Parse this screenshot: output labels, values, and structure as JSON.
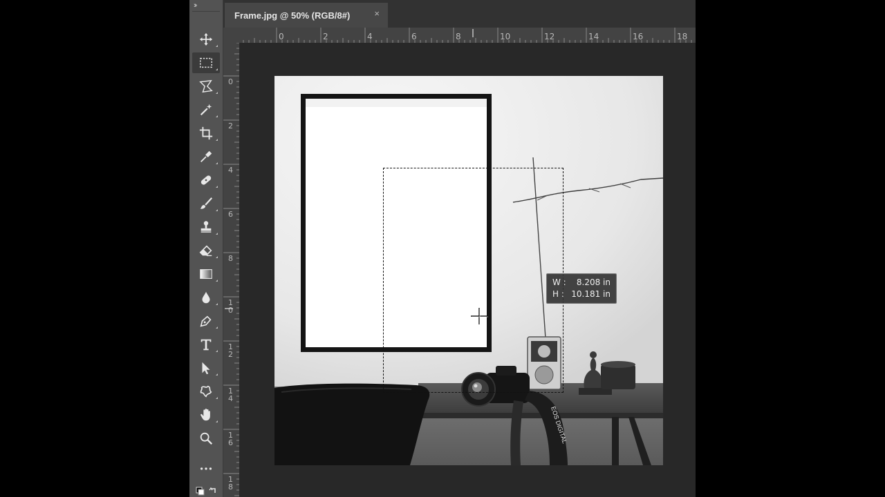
{
  "document_tab": {
    "title": "Frame.jpg @ 50% (RGB/8#)",
    "close_symbol": "×"
  },
  "toolbar": {
    "grip": "››",
    "tools": [
      {
        "name": "move-tool",
        "icon": "move-icon"
      },
      {
        "name": "rectangular-marquee-tool",
        "icon": "marquee-icon",
        "active": true
      },
      {
        "name": "polygonal-lasso-tool",
        "icon": "lasso-icon"
      },
      {
        "name": "magic-wand-tool",
        "icon": "magic-wand-icon"
      },
      {
        "name": "crop-tool",
        "icon": "crop-icon"
      },
      {
        "name": "eyedropper-tool",
        "icon": "eyedropper-icon"
      },
      {
        "name": "healing-brush-tool",
        "icon": "bandage-icon"
      },
      {
        "name": "brush-tool",
        "icon": "brush-icon"
      },
      {
        "name": "clone-stamp-tool",
        "icon": "stamp-icon"
      },
      {
        "name": "eraser-tool",
        "icon": "eraser-icon"
      },
      {
        "name": "gradient-tool",
        "icon": "gradient-icon"
      },
      {
        "name": "blur-tool",
        "icon": "drop-icon"
      },
      {
        "name": "pen-tool",
        "icon": "pen-icon"
      },
      {
        "name": "type-tool",
        "icon": "type-icon"
      },
      {
        "name": "path-selection-tool",
        "icon": "arrow-icon"
      },
      {
        "name": "custom-shape-tool",
        "icon": "shape-icon"
      },
      {
        "name": "hand-tool",
        "icon": "hand-icon"
      },
      {
        "name": "zoom-tool",
        "icon": "zoom-icon"
      },
      {
        "name": "edit-toolbar",
        "icon": "more-icon"
      }
    ]
  },
  "ruler_top_labels": [
    "0",
    "2",
    "4",
    "6",
    "8",
    "10",
    "12",
    "14",
    "16",
    "18"
  ],
  "ruler_left_labels": [
    "0",
    "2",
    "4",
    "6",
    "8",
    "10",
    "12",
    "14",
    "16",
    "18"
  ],
  "tooltip": {
    "w_label": "W :",
    "w_value": "8.208 in",
    "h_label": "H :",
    "h_value": "10.181 in"
  },
  "photo": {
    "camera_strap_text": "EOS DIGITAL"
  }
}
